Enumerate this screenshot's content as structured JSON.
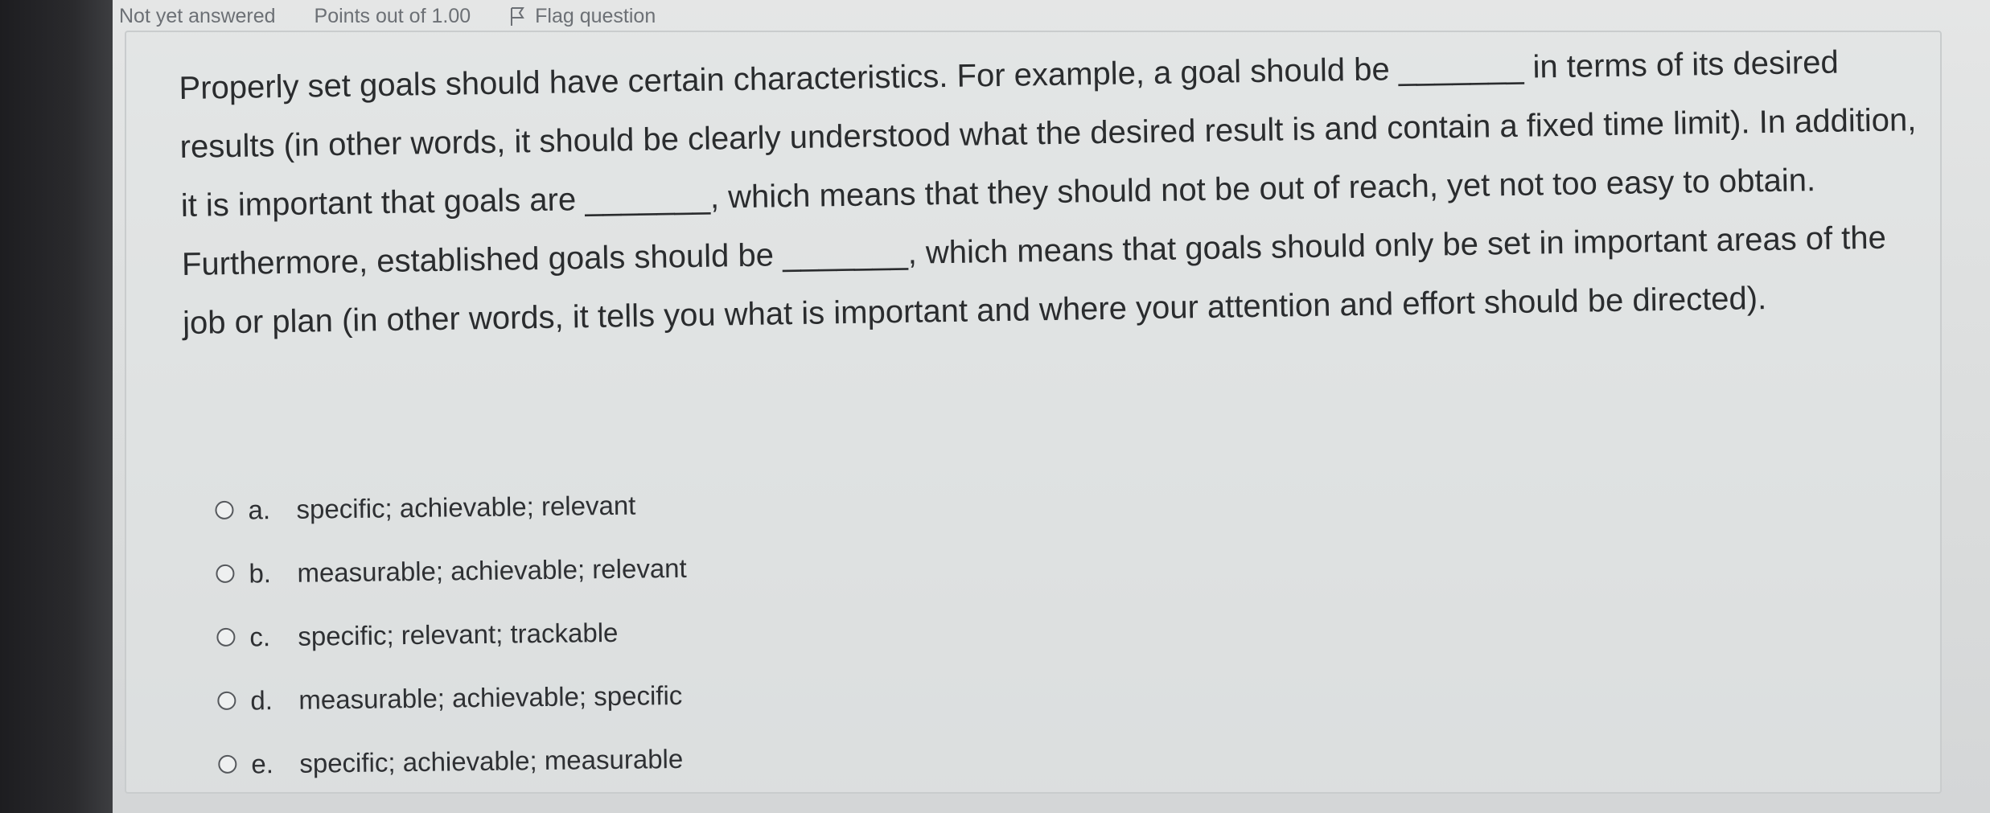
{
  "question_info": {
    "status": "Not yet answered",
    "points": "Points out of 1.00",
    "flag_label": "Flag question"
  },
  "question": {
    "text": "Properly set goals should have certain characteristics. For example, a goal should be _______ in terms of its desired results (in other words, it should be clearly understood what the desired result is and contain a fixed time limit). In addition, it is important that goals are _______, which means that they should not be out of reach, yet not too easy to obtain. Furthermore, established goals should be _______, which means that goals should only be set in important areas of the job or plan (in other words, it tells you what is important and where your attention and effort should be directed)."
  },
  "options": [
    {
      "letter": "a.",
      "text": "specific; achievable; relevant"
    },
    {
      "letter": "b.",
      "text": "measurable; achievable; relevant"
    },
    {
      "letter": "c.",
      "text": "specific; relevant; trackable"
    },
    {
      "letter": "d.",
      "text": "measurable; achievable; specific"
    },
    {
      "letter": "e.",
      "text": "specific; achievable; measurable"
    }
  ],
  "icons": {
    "flag": "flag-icon",
    "radio": "radio-button"
  }
}
